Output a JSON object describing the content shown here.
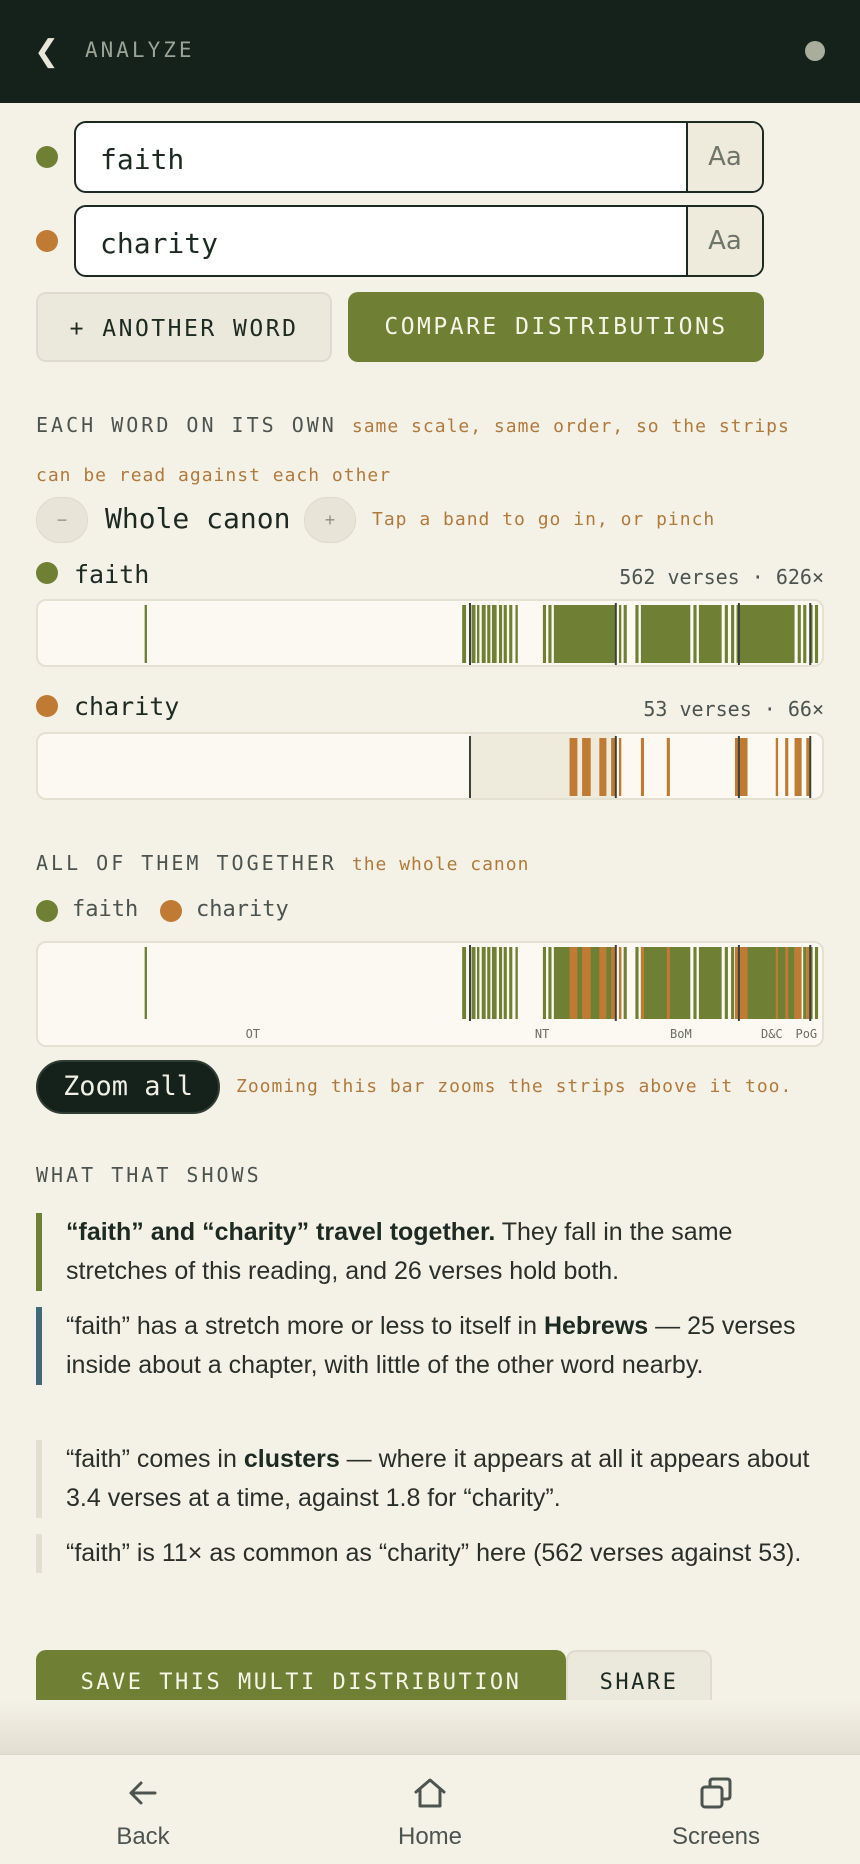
{
  "header": {
    "title": "ANALYZE",
    "back_icon": "chevron-left-icon"
  },
  "words": [
    {
      "value": "faith",
      "color": "#6f8034",
      "case_label": "Aa"
    },
    {
      "value": "charity",
      "color": "#bf7a34",
      "case_label": "Aa"
    }
  ],
  "actions": {
    "add_word": "+ ANOTHER WORD",
    "compare": "COMPARE DISTRIBUTIONS"
  },
  "each_section": {
    "heading": "EACH WORD ON ITS OWN",
    "note_line1": "same scale, same order, so the strips",
    "note_line2": "can be read against each other",
    "zoom_out_label": "−",
    "zoom_in_label": "+",
    "range_label": "Whole canon",
    "hint": "Tap a band to go in, or pinch"
  },
  "series": [
    {
      "name": "faith",
      "stat": "562 verses · 626×",
      "color": "#6f8034",
      "marks": [
        [
          0.136,
          0.139
        ],
        [
          0.541,
          0.546
        ],
        [
          0.553,
          0.558
        ],
        [
          0.56,
          0.563
        ],
        [
          0.566,
          0.571
        ],
        [
          0.573,
          0.577
        ],
        [
          0.579,
          0.585
        ],
        [
          0.588,
          0.592
        ],
        [
          0.594,
          0.598
        ],
        [
          0.601,
          0.605
        ],
        [
          0.609,
          0.612
        ],
        [
          0.644,
          0.648
        ],
        [
          0.651,
          0.655
        ],
        [
          0.658,
          0.737
        ],
        [
          0.741,
          0.744
        ],
        [
          0.747,
          0.751
        ],
        [
          0.762,
          0.766
        ],
        [
          0.769,
          0.832
        ],
        [
          0.836,
          0.84
        ],
        [
          0.843,
          0.872
        ],
        [
          0.876,
          0.88
        ],
        [
          0.884,
          0.888
        ],
        [
          0.891,
          0.965
        ],
        [
          0.969,
          0.973
        ],
        [
          0.976,
          0.98
        ],
        [
          0.984,
          0.988
        ],
        [
          0.991,
          0.995
        ]
      ]
    },
    {
      "name": "charity",
      "stat": "53 verses · 66×",
      "color": "#bf7a34",
      "marks": [
        [
          0.678,
          0.688
        ],
        [
          0.694,
          0.705
        ],
        [
          0.716,
          0.725
        ],
        [
          0.731,
          0.736
        ],
        [
          0.741,
          0.744
        ],
        [
          0.769,
          0.773
        ],
        [
          0.802,
          0.806
        ],
        [
          0.889,
          0.905
        ],
        [
          0.941,
          0.944
        ],
        [
          0.953,
          0.957
        ],
        [
          0.965,
          0.974
        ],
        [
          0.98,
          0.984
        ]
      ]
    }
  ],
  "charity_highlight": [
    0.551,
    0.737
  ],
  "dividers": [
    0.551,
    0.737,
    0.894,
    0.985
  ],
  "together_section": {
    "heading": "ALL OF THEM TOGETHER",
    "note": "the whole canon",
    "legend": [
      "faith",
      "charity"
    ]
  },
  "sections": [
    {
      "label": "OT",
      "pos": 0.274
    },
    {
      "label": "NT",
      "pos": 0.643
    },
    {
      "label": "BoM",
      "pos": 0.82
    },
    {
      "label": "D&C",
      "pos": 0.936
    },
    {
      "label": "PoG",
      "pos": 0.98
    }
  ],
  "zoom_all": {
    "label": "Zoom all",
    "note": "Zooming this bar zooms the strips above it too."
  },
  "findings_section": {
    "heading": "WHAT THAT SHOWS",
    "items": [
      {
        "bar_color": "#6f8034",
        "strong": "“faith” and “charity” travel together.",
        "rest": " They fall in the same stretches of this reading, and 26 verses hold both."
      },
      {
        "bar_color": "#3f6a7c",
        "pre": "“faith” has a stretch more or less to itself in ",
        "strong": "Hebrews",
        "rest": " — 25 verses inside about a chapter, with little of the other word nearby."
      },
      {
        "bar_color": "#e3dfd0",
        "pre": "“faith” comes in ",
        "strong": "clusters",
        "rest": " — where it appears at all it appears about 3.4 verses at a time, against 1.8 for “charity”."
      },
      {
        "bar_color": "#e3dfd0",
        "pre": "“faith” is 11× as common as “charity” here (562 verses against 53)."
      }
    ]
  },
  "footer_actions": {
    "save": "SAVE THIS MULTI DISTRIBUTION",
    "share": "SHARE"
  },
  "bottom_nav": [
    {
      "label": "Back",
      "icon": "arrow-left-icon"
    },
    {
      "label": "Home",
      "icon": "home-icon"
    },
    {
      "label": "Screens",
      "icon": "screens-icon"
    }
  ]
}
